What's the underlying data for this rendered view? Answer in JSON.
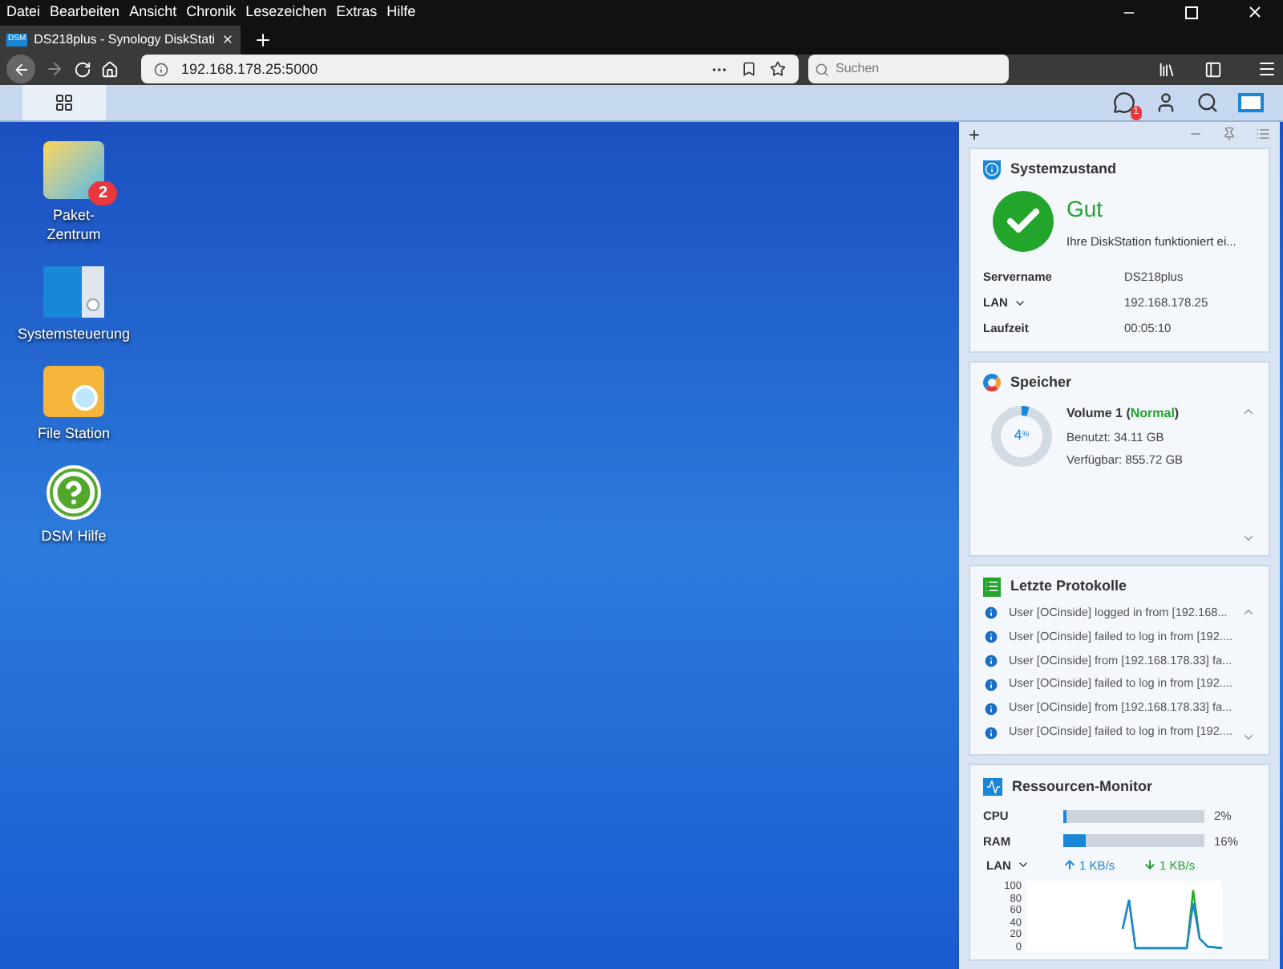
{
  "menu_bar": [
    "Datei",
    "Bearbeiten",
    "Ansicht",
    "Chronik",
    "Lesezeichen",
    "Extras",
    "Hilfe"
  ],
  "browser_tab": {
    "favicon": "DSM",
    "title": "DS218plus - Synology DiskStati",
    "selected": true
  },
  "address_bar": {
    "value": "192.168.178.25:5000"
  },
  "search_field": {
    "placeholder": "Suchen"
  },
  "taskbar": {
    "notification_count": "1"
  },
  "desktop_icons": [
    {
      "kind": "package",
      "label": "Paket-\nZentrum",
      "badge": "2"
    },
    {
      "kind": "control",
      "label": "Systemsteuerung"
    },
    {
      "kind": "folder",
      "label": "File Station"
    },
    {
      "kind": "help",
      "label": "DSM Hilfe"
    }
  ],
  "widget_panel": {
    "add": "+",
    "system_health": {
      "title": "Systemzustand",
      "status": "Gut",
      "message": "Ihre DiskStation funktioniert ei...",
      "rows": [
        {
          "label": "Servername",
          "value": "DS218plus",
          "dropdown": false
        },
        {
          "label": "LAN",
          "value": "192.168.178.25",
          "dropdown": true
        },
        {
          "label": "Laufzeit",
          "value": "00:05:10",
          "dropdown": false
        }
      ]
    },
    "storage": {
      "title": "Speicher",
      "percent": "4",
      "unit": "%",
      "level": 0.04,
      "volume": "Volume 1 (",
      "volume_status": "Normal",
      "volume_end": ")",
      "used": "Benutzt: 34.11 GB",
      "free": "Verfügbar: 855.72 GB"
    },
    "logs": {
      "title": "Letzte Protokolle",
      "items": [
        "User [OCinside] logged in from [192.168...",
        "User [OCinside] failed to log in from [192....",
        "User [OCinside] from [192.168.178.33] fa...",
        "User [OCinside] failed to log in from [192....",
        "User [OCinside] from [192.168.178.33] fa...",
        "User [OCinside] failed to log in from [192...."
      ]
    },
    "resource_monitor": {
      "title": "Ressourcen-Monitor",
      "meters": [
        {
          "label": "CPU",
          "level": 0.02,
          "reading": "2%"
        },
        {
          "label": "RAM",
          "level": 0.16,
          "reading": "16%"
        }
      ],
      "lan_label": "LAN",
      "upload": "1 KB/s",
      "download": "1 KB/s",
      "chart_ticks": [
        "100",
        "80",
        "60",
        "40",
        "20",
        "0"
      ]
    }
  }
}
